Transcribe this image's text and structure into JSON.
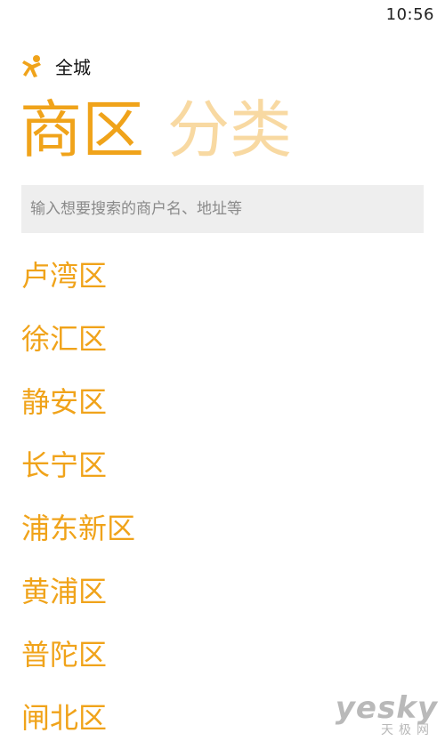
{
  "status_bar": {
    "time": "10:56"
  },
  "header": {
    "logo_icon": "person-logo-icon",
    "city": "全城"
  },
  "pivot": {
    "tabs": [
      {
        "label": "商区",
        "active": true
      },
      {
        "label": "分类",
        "active": false
      }
    ]
  },
  "search": {
    "value": "",
    "placeholder": "输入想要搜索的商户名、地址等"
  },
  "districts": [
    "卢湾区",
    "徐汇区",
    "静安区",
    "长宁区",
    "浦东新区",
    "黄浦区",
    "普陀区",
    "闸北区"
  ],
  "watermark": {
    "main": "yesky",
    "sub": "天极网"
  },
  "colors": {
    "accent": "#f0a31a",
    "accent_faded": "#f8d9a2",
    "search_bg": "#eeeeee"
  }
}
